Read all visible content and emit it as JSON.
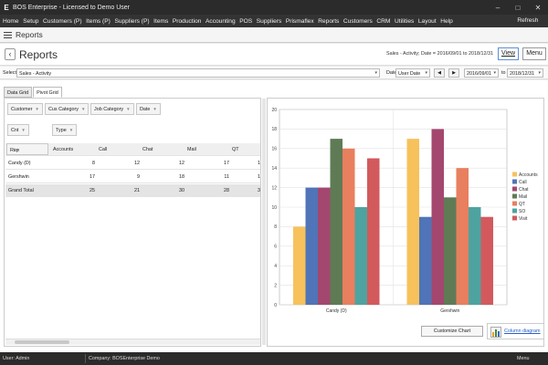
{
  "window": {
    "title": "BOS Enterprise - Licensed to Demo User",
    "logo": "E"
  },
  "menu": {
    "items": [
      "Home",
      "Setup",
      "Customers (P)",
      "Items (P)",
      "Suppliers (P)",
      "Items",
      "Production",
      "Accounting",
      "POS",
      "Suppliers",
      "Prismaflex",
      "Reports",
      "Customers",
      "CRM",
      "Utilities",
      "Layout",
      "Help"
    ],
    "refresh": "Refresh"
  },
  "section": {
    "title": "Reports"
  },
  "header": {
    "title": "Reports",
    "summary": "Sales - Activity; Date = 2016/09/01 to 2018/12/31",
    "view": "View",
    "menu": "Menu"
  },
  "filters": {
    "select_label": "Select",
    "select_value": "Sales - Activity",
    "date_label": "Date",
    "date_field": "User Date",
    "from": "2016/09/01",
    "to_label": "to",
    "to": "2018/12/31"
  },
  "tabs": [
    "Data Grid",
    "Pivot Grid"
  ],
  "pivot": {
    "filter_fields": [
      "Customer",
      "Cus Category",
      "Job Category",
      "Date"
    ],
    "data_field": "Cnt",
    "column_field": "Type",
    "row_field": "Rep",
    "columns": [
      "Accounts",
      "Call",
      "Chat",
      "Mail",
      "QT"
    ],
    "rows": [
      {
        "label": "Candy (D)",
        "values": [
          "8",
          "12",
          "12",
          "17",
          "1"
        ]
      },
      {
        "label": "Gershwin",
        "values": [
          "17",
          "9",
          "18",
          "11",
          "1"
        ]
      }
    ],
    "grand_total": {
      "label": "Grand Total",
      "values": [
        "25",
        "21",
        "30",
        "28",
        "3"
      ]
    }
  },
  "chart_data": {
    "type": "bar",
    "categories": [
      "Candy (D)",
      "Gershwin"
    ],
    "series": [
      {
        "name": "Accounts",
        "values": [
          8,
          17
        ],
        "color": "#f7c25c"
      },
      {
        "name": "Call",
        "values": [
          12,
          9
        ],
        "color": "#4f74b8"
      },
      {
        "name": "Chat",
        "values": [
          12,
          18
        ],
        "color": "#a4476f"
      },
      {
        "name": "Mail",
        "values": [
          17,
          11
        ],
        "color": "#5e7b56"
      },
      {
        "name": "QT",
        "values": [
          16,
          14
        ],
        "color": "#e87f5e"
      },
      {
        "name": "SO",
        "values": [
          10,
          10
        ],
        "color": "#4ea3a0"
      },
      {
        "name": "Visit",
        "values": [
          15,
          9
        ],
        "color": "#d25a5d"
      }
    ],
    "ylim": [
      0,
      20
    ],
    "yticks": [
      "0",
      "2",
      "4",
      "6",
      "8",
      "10",
      "12",
      "14",
      "16",
      "18",
      "20"
    ],
    "grid": true,
    "legend": "right"
  },
  "chart_buttons": {
    "customize": "Customize Chart",
    "type": "Column diagram"
  },
  "status": {
    "user": "User: Admin",
    "company": "Company: BOSEnterprise Demo",
    "menu": "Menu"
  }
}
